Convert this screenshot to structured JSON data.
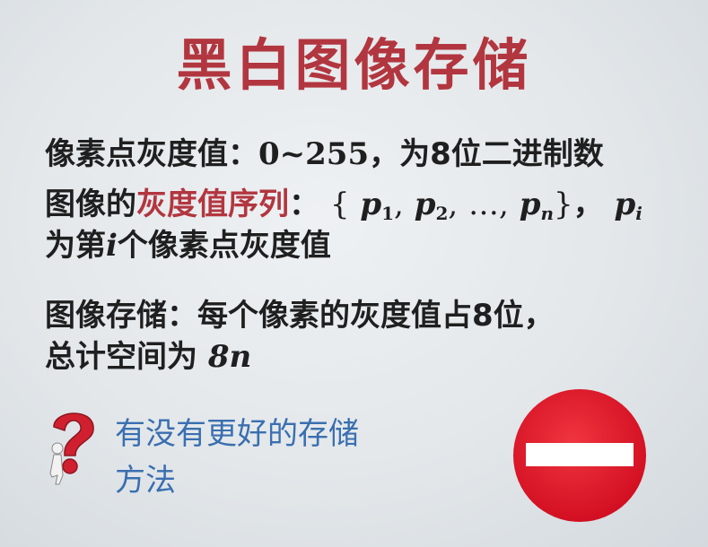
{
  "slide": {
    "title": "黑白图像存储",
    "line1": {
      "label": "像素点灰度值：",
      "range": "0~255",
      "rest": "，为8位二进制数"
    },
    "line2": {
      "prefix": "图像的",
      "highlight": "灰度值序列",
      "colon": "：",
      "brace_open": "{",
      "p": "p",
      "sub1": "1",
      "sub2": "2",
      "sub_n": "n",
      "sub_i": "i",
      "ellipsis": "…",
      "brace_close": "}",
      "comma": "，"
    },
    "line3": {
      "prefix": "为第",
      "i": "i",
      "rest": "个像素点灰度值"
    },
    "line4": "图像存储：每个像素的灰度值占8位，",
    "line5": {
      "prefix": "总计空间为 ",
      "value": "8n"
    },
    "question_line1": "有没有更好的存储",
    "question_line2": "方法"
  },
  "icons": {
    "question": "question-mark-figure-icon",
    "stop": "no-entry-sign-icon"
  },
  "colors": {
    "title": "#b2363f",
    "highlight": "#b2363f",
    "question_text": "#3a6fb0",
    "stop_red": "#e5142a"
  }
}
